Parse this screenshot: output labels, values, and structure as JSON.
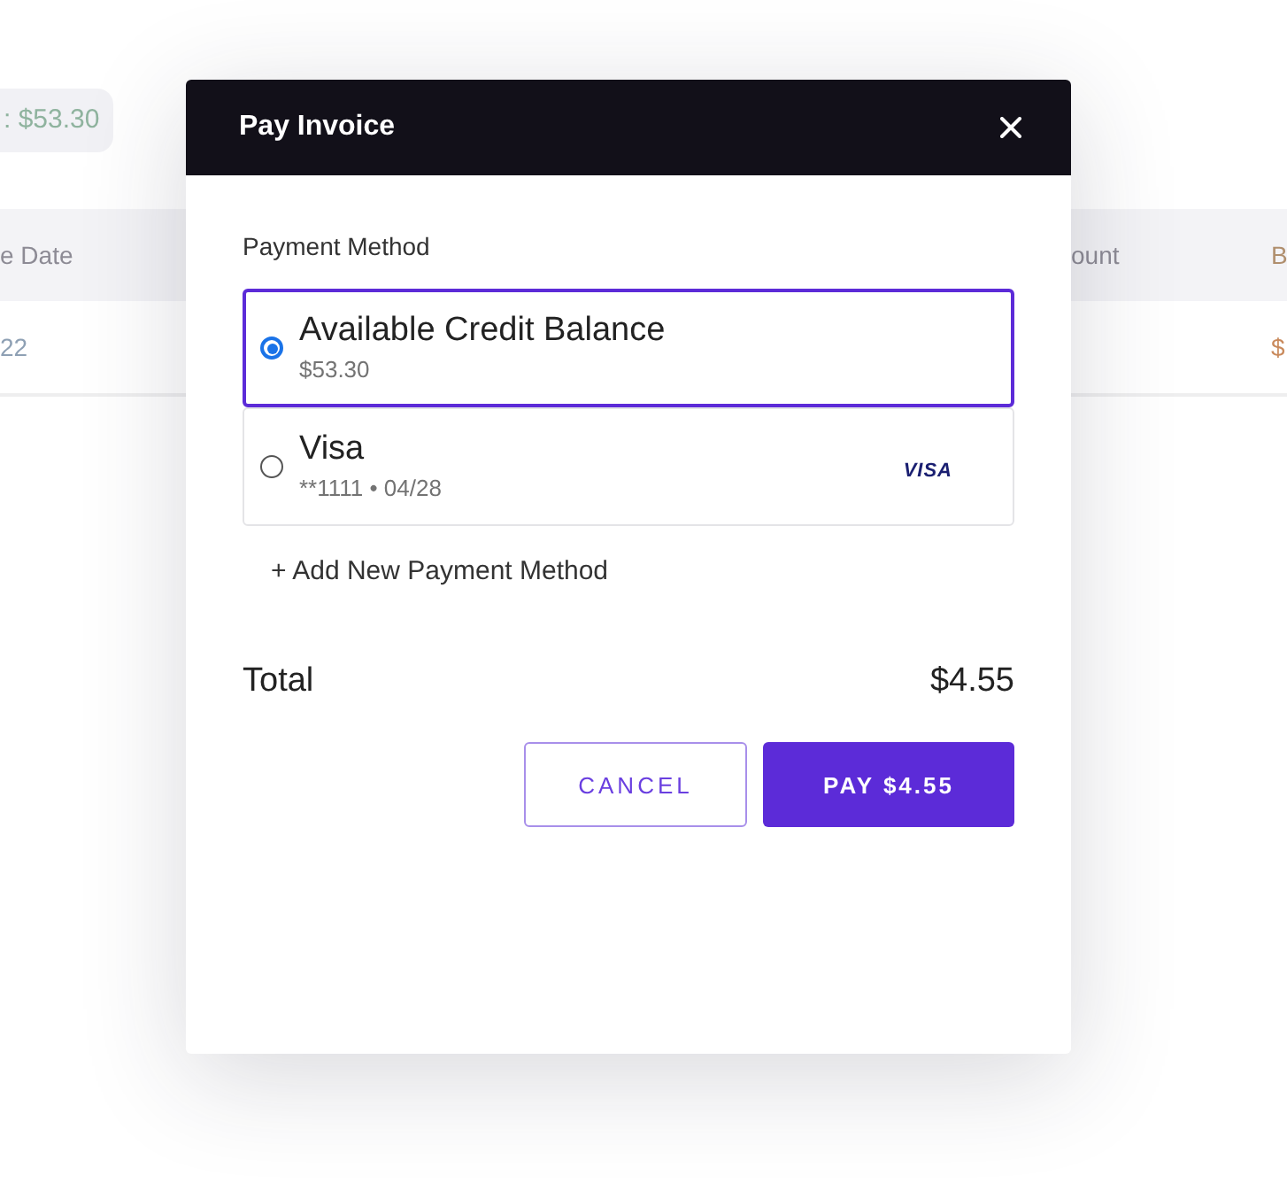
{
  "background": {
    "balance_pill": ": $53.30",
    "table": {
      "columns": {
        "column_1": "e Date",
        "column_2": "ount",
        "column_3": "B"
      },
      "row": {
        "column_1": "22",
        "column_3": "$"
      }
    }
  },
  "dialog": {
    "title": "Pay Invoice",
    "section_label": "Payment Method",
    "payment_methods": [
      {
        "kind": "credit",
        "name": "Available Credit Balance",
        "detail": "$53.30",
        "selected": true
      },
      {
        "kind": "card",
        "name": "Visa",
        "detail": "**1111 • 04/28",
        "card_logo": "VISA",
        "selected": false
      }
    ],
    "add_method": "+ Add New Payment Method",
    "total": {
      "label": "Total",
      "amount": "$4.55"
    },
    "buttons": [
      {
        "kind": "secondary",
        "label": "CANCEL"
      },
      {
        "kind": "primary",
        "label": "PAY $4.55"
      }
    ]
  }
}
